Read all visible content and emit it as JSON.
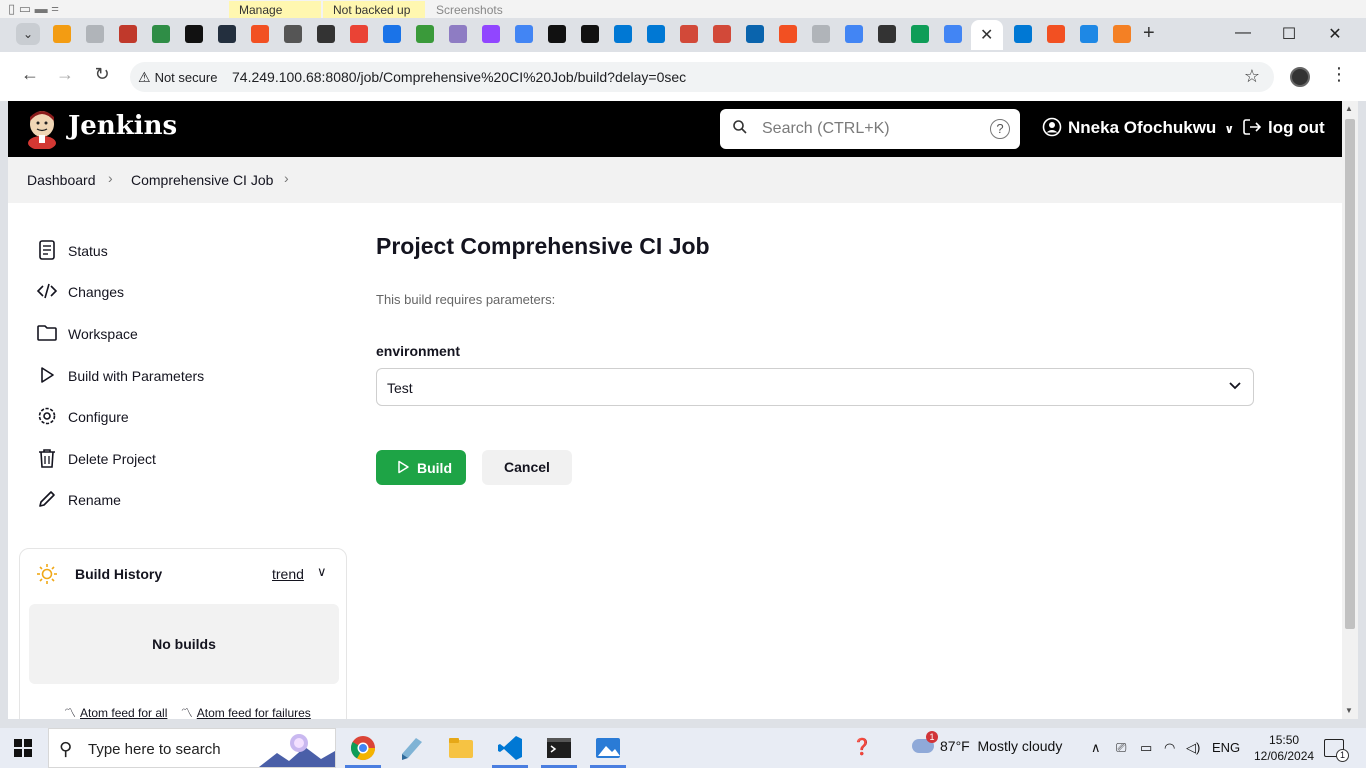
{
  "background": {
    "tags": [
      "Manage",
      "Not backed up",
      "Screenshots"
    ]
  },
  "browser": {
    "tab_icons": [
      {
        "icon": "box-icon",
        "color": "#f39c12"
      },
      {
        "icon": "collapse-icon",
        "color": "#b0b4b9"
      },
      {
        "icon": "redis-icon",
        "color": "#c0392b"
      },
      {
        "icon": "geeks-icon",
        "color": "#2f8d46"
      },
      {
        "icon": "chart-icon",
        "color": "#111111"
      },
      {
        "icon": "aws-icon",
        "color": "#232f3e"
      },
      {
        "icon": "microsoft-icon",
        "color": "#f25022"
      },
      {
        "icon": "globe-icon",
        "color": "#555555"
      },
      {
        "icon": "openai-icon",
        "color": "#333333"
      },
      {
        "icon": "gmail-icon",
        "color": "#ea4335"
      },
      {
        "icon": "diamond-icon",
        "color": "#1a73e8"
      },
      {
        "icon": "frog-icon",
        "color": "#3a9a3a"
      },
      {
        "icon": "cube-icon",
        "color": "#8e7cc3"
      },
      {
        "icon": "twitch-icon",
        "color": "#9146ff"
      },
      {
        "icon": "docs-icon",
        "color": "#4285f4"
      },
      {
        "icon": "github-icon",
        "color": "#111111"
      },
      {
        "icon": "github-icon",
        "color": "#111111"
      },
      {
        "icon": "azure-icon",
        "color": "#0078d4"
      },
      {
        "icon": "azure-icon",
        "color": "#0078d4"
      },
      {
        "icon": "jenkins-icon",
        "color": "#d24939"
      },
      {
        "icon": "jenkins-icon",
        "color": "#d24939"
      },
      {
        "icon": "outlook-icon",
        "color": "#0a64ad"
      },
      {
        "icon": "microsoft-icon",
        "color": "#f25022"
      },
      {
        "icon": "collapse-icon",
        "color": "#b0b4b9"
      },
      {
        "icon": "google-icon",
        "color": "#4285f4"
      },
      {
        "icon": "openai-icon",
        "color": "#333333"
      },
      {
        "icon": "drive-icon",
        "color": "#0f9d58"
      },
      {
        "icon": "docs-icon",
        "color": "#4285f4"
      }
    ],
    "tab_icons_after": [
      {
        "icon": "azure-icon",
        "color": "#0078d4"
      },
      {
        "icon": "microsoft-icon",
        "color": "#f25022"
      },
      {
        "icon": "edge-icon",
        "color": "#1e88e5"
      },
      {
        "icon": "stackoverflow-icon",
        "color": "#f48024"
      }
    ],
    "not_secure": "Not secure",
    "url": "74.249.100.68:8080/job/Comprehensive%20CI%20Job/build?delay=0sec"
  },
  "jenkins": {
    "brand": "Jenkins",
    "search_placeholder": "Search (CTRL+K)",
    "help": "?",
    "user": "Nneka Ofochukwu",
    "logout": "log out",
    "breadcrumbs": [
      "Dashboard",
      "Comprehensive CI Job"
    ],
    "side_items": [
      {
        "label": "Status",
        "icon": "notepad-icon"
      },
      {
        "label": "Changes",
        "icon": "code-icon"
      },
      {
        "label": "Workspace",
        "icon": "folder-icon"
      },
      {
        "label": "Build with Parameters",
        "icon": "play-icon"
      },
      {
        "label": "Configure",
        "icon": "gear-icon"
      },
      {
        "label": "Delete Project",
        "icon": "trash-icon"
      },
      {
        "label": "Rename",
        "icon": "pencil-icon"
      }
    ],
    "build_history": {
      "title": "Build History",
      "trend": "trend",
      "empty": "No builds",
      "feed_all": "Atom feed for all",
      "feed_failures": "Atom feed for failures"
    },
    "main": {
      "title": "Project Comprehensive CI Job",
      "requires": "This build requires parameters:",
      "param_label": "environment",
      "param_value": "Test",
      "build": "Build",
      "cancel": "Cancel"
    },
    "colors": {
      "build_green": "#1ea446",
      "header_black": "#000000"
    }
  },
  "taskbar": {
    "search_placeholder": "Type here to search",
    "weather_badge": "1",
    "temperature": "87°F",
    "weather": "Mostly cloudy",
    "language": "ENG",
    "time": "15:50",
    "date": "12/06/2024",
    "notifications": "1"
  }
}
